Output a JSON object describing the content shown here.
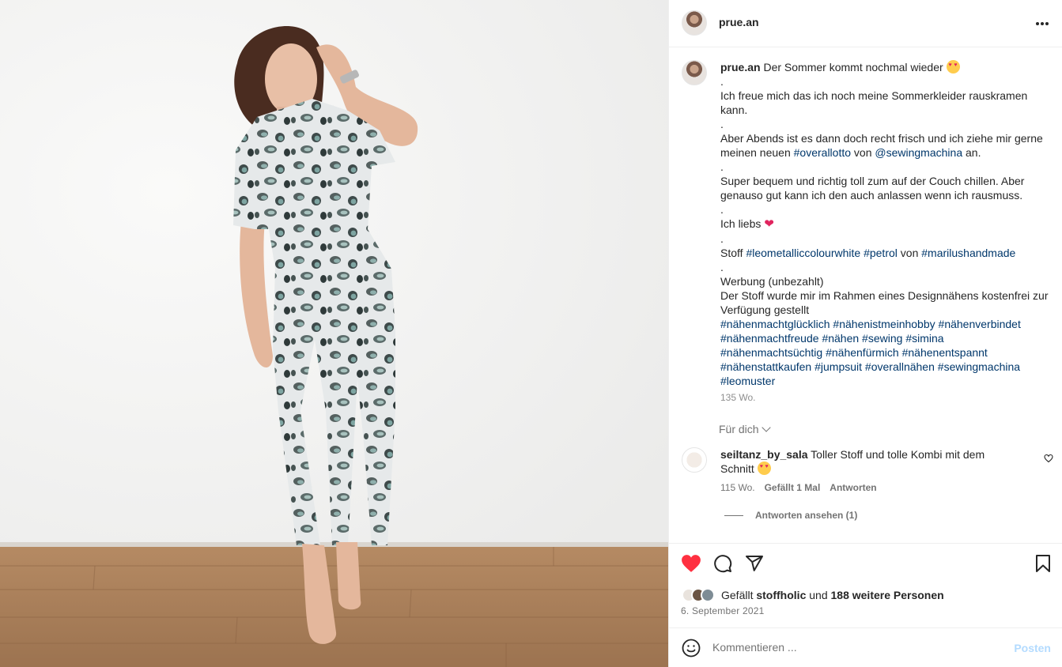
{
  "post": {
    "username": "prue.an",
    "photo_alt": "Frau in Leoparden-Overall"
  },
  "caption": {
    "username": "prue.an",
    "lines": [
      "Der Sommer kommt nochmal wieder",
      ".",
      "Ich freue mich das ich noch meine Sommerkleider rauskramen kann.",
      ".",
      "Aber Abends ist es dann doch recht frisch und ich ziehe mir gerne meinen neuen",
      "#overallotto",
      "von",
      "@sewingmachina",
      "an.",
      ".",
      "Super bequem und richtig toll zum auf der Couch chillen. Aber genauso gut kann ich den auch anlassen wenn ich rausmuss.",
      ".",
      "Ich liebs",
      ".",
      "Stoff",
      "#leometalliccolourwhite",
      "#petrol",
      "von",
      "#marilushandmade",
      ".",
      "Werbung (unbezahlt)",
      "Der Stoff wurde mir im Rahmen eines Designnähens kostenfrei zur Verfügung gestellt"
    ],
    "hashtags": [
      "#nähenmachtglücklich",
      "#nähenistmeinhobby",
      "#nähenverbindet",
      "#nähenmachtfreude",
      "#nähen",
      "#sewing",
      "#simina",
      "#nähenmachtsüchtig",
      "#nähenfürmich",
      "#nähenentspannt",
      "#nähenstattkaufen",
      "#jumpsuit",
      "#overallnähen",
      "#sewingmachina",
      "#leomuster"
    ],
    "time": "135 Wo."
  },
  "filter": {
    "label": "Für dich"
  },
  "comment": {
    "username": "seiltanz_by_sala",
    "text": "Toller Stoff und tolle Kombi mit dem Schnitt",
    "time": "115 Wo.",
    "likes": "Gefällt 1 Mal",
    "reply": "Antworten",
    "view_replies": "Antworten ansehen (1)"
  },
  "likes": {
    "prefix": "Gefällt",
    "user": "stoffholic",
    "conj": "und",
    "others": "188 weitere Personen"
  },
  "date": "6. September 2021",
  "comment_box": {
    "placeholder": "Kommentieren ...",
    "post_label": "Posten"
  },
  "colors": {
    "link": "#00376b",
    "like_red": "#ff3040",
    "post_disabled": "#b3dbff",
    "muted": "#737373"
  },
  "icons": [
    "more-icon",
    "heart-icon",
    "comment-icon",
    "share-icon",
    "bookmark-icon",
    "smile-icon",
    "chevron-down-icon"
  ]
}
